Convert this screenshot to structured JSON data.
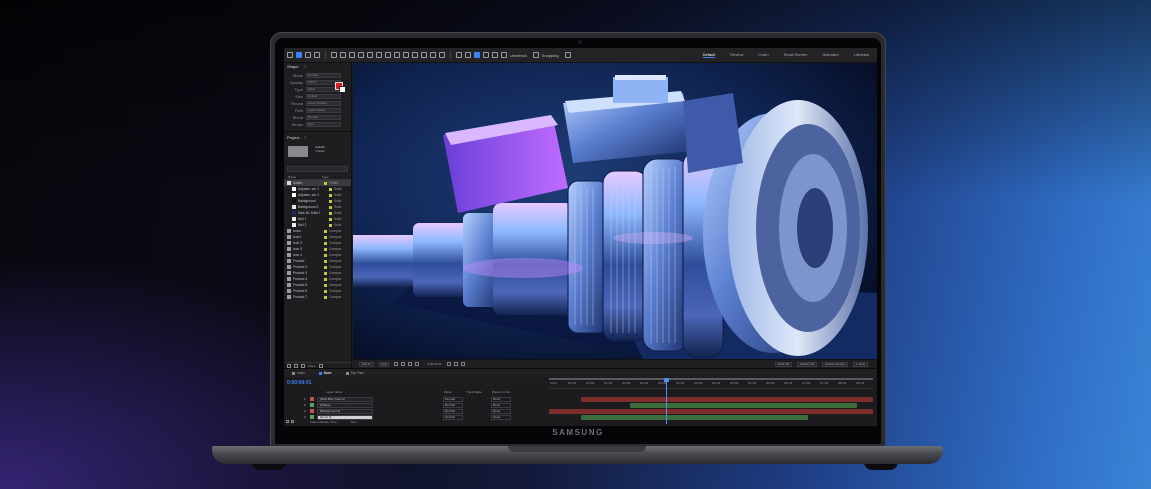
{
  "device": {
    "brand": "SAMSUNG"
  },
  "toolbar": {
    "universal_label": "Universal",
    "snapping_label": "Snapping",
    "workspaces": [
      "Default",
      "Review",
      "Learn",
      "Small Screen",
      "Standard",
      "Libraries"
    ],
    "active_workspace": "Default"
  },
  "properties_panel": {
    "title": "Shape",
    "rows": [
      {
        "label": "Mode",
        "value": "Normal"
      },
      {
        "label": "Opacity",
        "value": "100 %"
      },
      {
        "label": "Type",
        "value": "Solid"
      },
      {
        "label": "Size",
        "value": "Default"
      },
      {
        "label": "Round",
        "value": "Layer Content"
      },
      {
        "label": "Path",
        "value": "Layer Masks"
      },
      {
        "label": "Blend",
        "value": "Normal"
      },
      {
        "label": "Stroke",
        "value": "0 px"
      }
    ],
    "fill_color": "#e11d1d"
  },
  "project_panel": {
    "title": "Project",
    "item_name": "Solids",
    "item_meta": "7 items",
    "columns": {
      "name": "Name",
      "type": "Type"
    },
    "items": [
      {
        "name": "Solids",
        "type": "Folder",
        "selected": true,
        "depth": 0,
        "swatch": "#d9d9dd"
      },
      {
        "name": "Adjustm..ver 1",
        "type": "Solid",
        "depth": 1,
        "swatch": "#ffffff"
      },
      {
        "name": "Adjustm..ver 2",
        "type": "Solid",
        "depth": 1,
        "swatch": "#ffffff"
      },
      {
        "name": "Background",
        "type": "Solid",
        "depth": 1,
        "swatch": "#111111"
      },
      {
        "name": "Background 2",
        "type": "Solid",
        "depth": 1,
        "swatch": "#e8e8ea"
      },
      {
        "name": "Dark Bl..Solid 1",
        "type": "Solid",
        "depth": 1,
        "swatch": "#1c2c5e"
      },
      {
        "name": "Null 1",
        "type": "Solid",
        "depth": 1,
        "swatch": "#eeeeee"
      },
      {
        "name": "Null 2",
        "type": "Solid",
        "depth": 1,
        "swatch": "#eeeeee"
      },
      {
        "name": "Icons",
        "type": "Compos",
        "depth": 0,
        "swatch": "#9c9ca3"
      },
      {
        "name": "Icon1",
        "type": "Compos",
        "depth": 0,
        "swatch": "#9c9ca3"
      },
      {
        "name": "Icon 2",
        "type": "Compos",
        "depth": 0,
        "swatch": "#9c9ca3"
      },
      {
        "name": "Icon 3",
        "type": "Compos",
        "depth": 0,
        "swatch": "#9c9ca3"
      },
      {
        "name": "Icon 4",
        "type": "Compos",
        "depth": 0,
        "swatch": "#9c9ca3"
      },
      {
        "name": "Product",
        "type": "Compos",
        "depth": 0,
        "swatch": "#9c9ca3"
      },
      {
        "name": "Product 2",
        "type": "Compos",
        "depth": 0,
        "swatch": "#9c9ca3"
      },
      {
        "name": "Product 3",
        "type": "Compos",
        "depth": 0,
        "swatch": "#9c9ca3"
      },
      {
        "name": "Product 4",
        "type": "Compos",
        "depth": 0,
        "swatch": "#9c9ca3"
      },
      {
        "name": "Product 5",
        "type": "Compos",
        "depth": 0,
        "swatch": "#9c9ca3"
      },
      {
        "name": "Product 6",
        "type": "Compos",
        "depth": 0,
        "swatch": "#9c9ca3"
      },
      {
        "name": "Product 7",
        "type": "Compos",
        "depth": 0,
        "swatch": "#9c9ca3"
      }
    ],
    "bpc": "8 bpc"
  },
  "viewer": {
    "zoom": "100 %",
    "resolution": "Full",
    "timecode": "0:00:00:01",
    "view_mode": "Draft 3D",
    "camera": "Active Camera",
    "views": "1 View",
    "renderer": "Classic 3D"
  },
  "timeline": {
    "tabs": [
      {
        "label": "main",
        "active": false
      },
      {
        "label": "Base",
        "active": true
      },
      {
        "label": "Top Part",
        "active": false
      }
    ],
    "timecode": "0:00:00:01",
    "columns": {
      "layer_name": "Layer Name",
      "mode": "Mode",
      "track_matte": "Track Matte",
      "parent": "Parent & Link"
    },
    "layers": [
      {
        "index": "1",
        "name": "[Dark Blue Solid 1]",
        "mode": "Normal",
        "parent": "None",
        "color": "#c2544d",
        "track": "#7b2e2b",
        "track_start": 0.1,
        "track_end": 1.0
      },
      {
        "index": "2",
        "name": "[Shape]",
        "mode": "Normal",
        "parent": "None",
        "color": "#58a060",
        "track": "#3a6d3b",
        "track_start": 0.25,
        "track_end": 0.95
      },
      {
        "index": "3",
        "name": "[Background 4]",
        "mode": "Normal",
        "parent": "None",
        "color": "#c2544d",
        "track": "#7b2e2b",
        "track_start": 0.0,
        "track_end": 1.0
      },
      {
        "index": "4",
        "name": "[Icons 3]",
        "mode": "Normal",
        "parent": "None",
        "color": "#58a060",
        "track": "#3a6d3b",
        "track_start": 0.1,
        "track_end": 0.8,
        "selected": true
      }
    ],
    "ruler_ticks": [
      "0:00f",
      "00:15f",
      "01:00f",
      "01:15f",
      "02:00f",
      "02:15f",
      "03:00f",
      "03:15f",
      "04:00f",
      "04:15f",
      "05:00f",
      "05:15f",
      "06:00f",
      "06:15f",
      "07:00f",
      "07:15f",
      "08:00f",
      "08:15f"
    ],
    "footer_label": "Frame Render Time",
    "footer_value": "0ms"
  }
}
